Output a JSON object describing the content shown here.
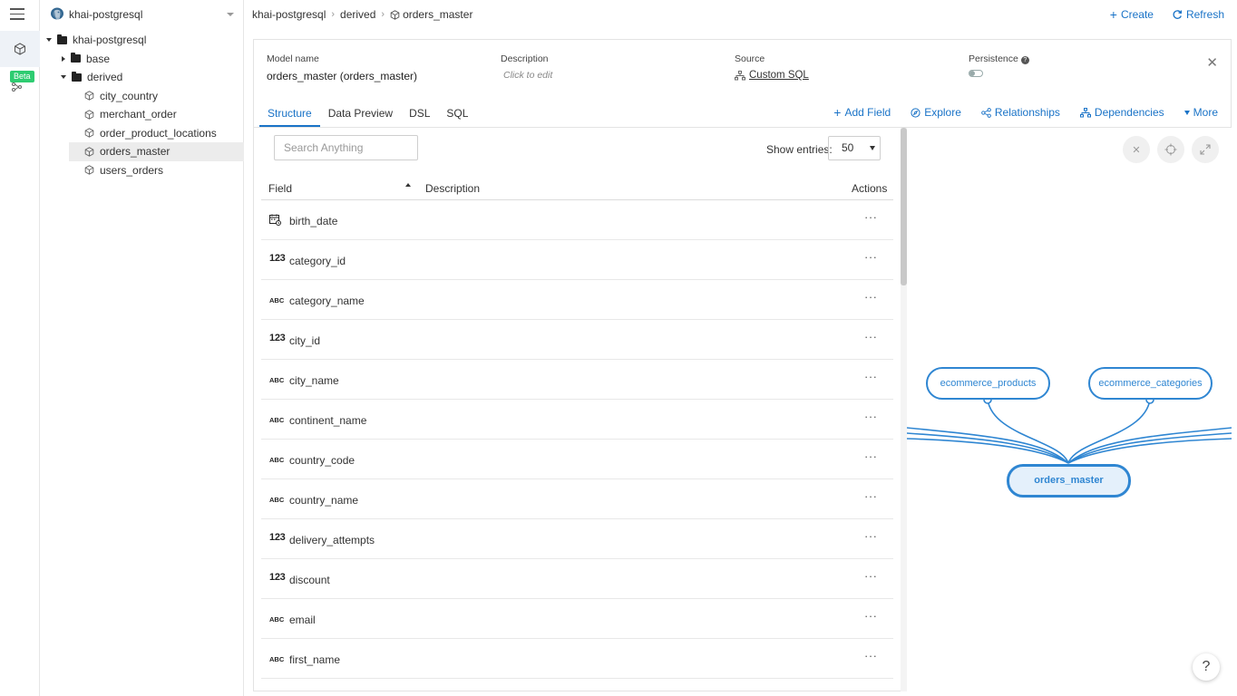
{
  "rail": {
    "beta_label": "Beta"
  },
  "sidebar": {
    "datasource": "khai-postgresql",
    "tree": {
      "root": "khai-postgresql",
      "folders": [
        {
          "label": "base",
          "expanded": false
        },
        {
          "label": "derived",
          "expanded": true
        }
      ],
      "models": [
        "city_country",
        "merchant_order",
        "order_product_locations",
        "orders_master",
        "users_orders"
      ],
      "selected": "orders_master"
    }
  },
  "breadcrumb": {
    "items": [
      "khai-postgresql",
      "derived"
    ],
    "current": "orders_master"
  },
  "top_actions": {
    "create": "Create",
    "refresh": "Refresh"
  },
  "meta": {
    "model_name_label": "Model name",
    "model_name_value": "orders_master (orders_master)",
    "description_label": "Description",
    "description_value": "Click to edit",
    "source_label": "Source",
    "source_value": "Custom SQL",
    "persistence_label": "Persistence",
    "persistence_help": "?"
  },
  "tabs": [
    {
      "label": "Structure",
      "active": true
    },
    {
      "label": "Data Preview",
      "active": false
    },
    {
      "label": "DSL",
      "active": false
    },
    {
      "label": "SQL",
      "active": false
    }
  ],
  "tab_actions": {
    "add_field": "Add Field",
    "explore": "Explore",
    "relationships": "Relationships",
    "dependencies": "Dependencies",
    "more": "More"
  },
  "table": {
    "search_placeholder": "Search Anything",
    "show_entries_label": "Show entries:",
    "entries_value": "50",
    "columns": {
      "field": "Field",
      "description": "Description",
      "actions": "Actions"
    },
    "actions_glyph": "···",
    "rows": [
      {
        "type": "date",
        "name": "birth_date"
      },
      {
        "type": "number",
        "type_label": "123",
        "name": "category_id"
      },
      {
        "type": "text",
        "type_label": "ABC",
        "name": "category_name"
      },
      {
        "type": "number",
        "type_label": "123",
        "name": "city_id"
      },
      {
        "type": "text",
        "type_label": "ABC",
        "name": "city_name"
      },
      {
        "type": "text",
        "type_label": "ABC",
        "name": "continent_name"
      },
      {
        "type": "text",
        "type_label": "ABC",
        "name": "country_code"
      },
      {
        "type": "text",
        "type_label": "ABC",
        "name": "country_name"
      },
      {
        "type": "number",
        "type_label": "123",
        "name": "delivery_attempts"
      },
      {
        "type": "number",
        "type_label": "123",
        "name": "discount"
      },
      {
        "type": "text",
        "type_label": "ABC",
        "name": "email"
      },
      {
        "type": "text",
        "type_label": "ABC",
        "name": "first_name"
      }
    ]
  },
  "graph": {
    "nodes": {
      "left": "ecommerce_products",
      "right": "ecommerce_categories",
      "main": "orders_master"
    },
    "help": "?",
    "accent": "#2f86d2"
  }
}
